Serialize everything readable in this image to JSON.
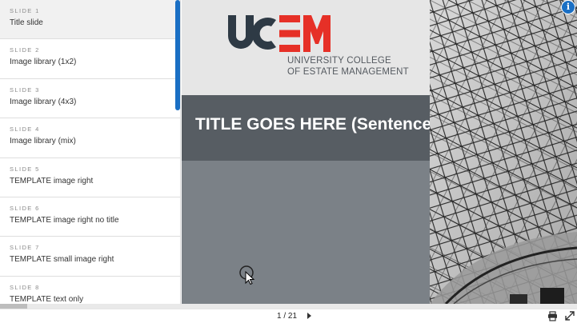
{
  "sidebar": {
    "items": [
      {
        "num": "SLIDE 1",
        "label": "Title slide"
      },
      {
        "num": "SLIDE 2",
        "label": "Image library (1x2)"
      },
      {
        "num": "SLIDE 3",
        "label": "Image library (4x3)"
      },
      {
        "num": "SLIDE 4",
        "label": "Image library (mix)"
      },
      {
        "num": "SLIDE 5",
        "label": "TEMPLATE image right"
      },
      {
        "num": "SLIDE 6",
        "label": "TEMPLATE image right no title"
      },
      {
        "num": "SLIDE 7",
        "label": "TEMPLATE small image right"
      },
      {
        "num": "SLIDE 8",
        "label": "TEMPLATE text only"
      }
    ],
    "active_index": 0
  },
  "slide": {
    "logo_uc": "UC",
    "logo_em": "EM",
    "logo_line1": "UNIVERSITY COLLEGE",
    "logo_line2": "OF ESTATE MANAGEMENT",
    "title": "TITLE GOES HERE (Sentence case)"
  },
  "footer": {
    "page_indicator": "1 / 21"
  },
  "icons": {
    "info": "info-icon",
    "print": "print-icon",
    "expand": "expand-icon",
    "next": "next-arrow-icon"
  },
  "colors": {
    "accent": "#1a6fc4",
    "brand_red": "#e63027",
    "brand_dark": "#2e3a45",
    "title_band": "#575d63",
    "body_grey": "#7b8187"
  }
}
